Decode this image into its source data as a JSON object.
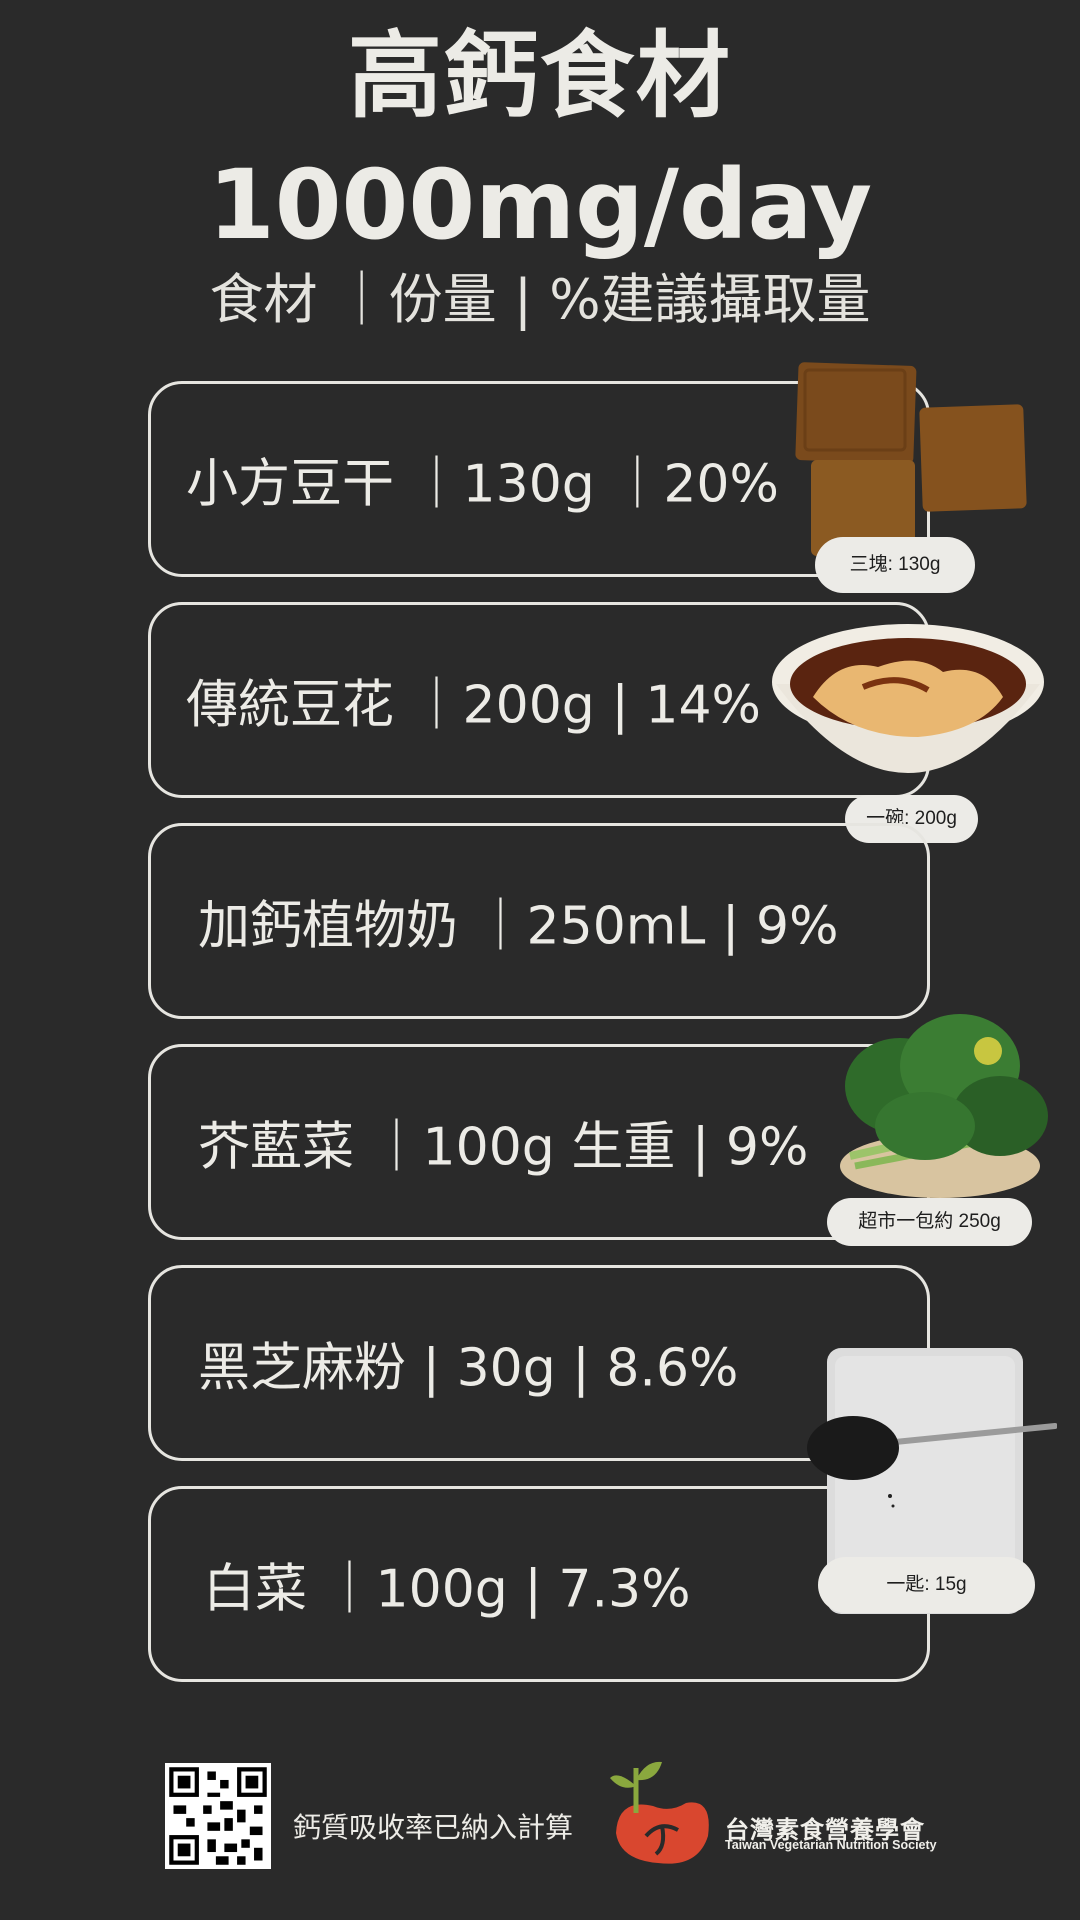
{
  "header": {
    "title": "高鈣食材",
    "goal": "1000mg/day",
    "subtitle": "食材 ｜份量 | %建議攝取量"
  },
  "items": [
    {
      "text": "小方豆干 ｜130g ｜20%",
      "tag": "三塊: 130g",
      "photo": "dried-tofu"
    },
    {
      "text": "傳統豆花 ｜200g | 14%",
      "tag": "一碗: 200g",
      "photo": "tofu-pudding"
    },
    {
      "text": "加鈣植物奶 ｜250mL | 9%",
      "tag": "",
      "photo": ""
    },
    {
      "text": "芥藍菜 ｜100g 生重 | 9%",
      "tag": "超市一包約  250g",
      "photo": "chinese-kale"
    },
    {
      "text": "黑芝麻粉 | 30g | 8.6%",
      "tag": "",
      "photo": "sesame-powder"
    },
    {
      "text": "白菜 ｜100g | 7.3%",
      "tag": "一匙: 15g",
      "photo": ""
    }
  ],
  "footer": {
    "note": "鈣質吸收率已納入計算",
    "org_cn": "台灣素食營養學會",
    "org_en": "Taiwan Vegetarian Nutrition Society",
    "logo_name": "seedling-logo",
    "qr_name": "qr-code"
  },
  "colors": {
    "background": "#2a2a2a",
    "text": "#ecebe6",
    "pill": "#ecebe7",
    "logo_red": "#d9472f",
    "logo_green": "#8aa83e"
  }
}
